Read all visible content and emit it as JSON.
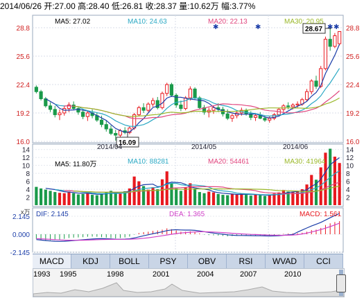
{
  "header": {
    "date": "2014/06/26",
    "open": "开:27.00",
    "high": "高:28.40",
    "low": "低:26.81",
    "close": "收:28.37",
    "volume": "量:10.62万",
    "change": "幅:3.77%"
  },
  "price_panel": {
    "ma5": "MA5: 27.02",
    "ma10": "MA10: 24.63",
    "ma20": "MA20: 22.13",
    "ma30": "MA30: 20.95",
    "y_ticks": [
      "28.8",
      "25.6",
      "22.4",
      "19.2",
      "16.0"
    ],
    "x_labels": [
      "2014/04",
      "2014/05",
      "2014/06"
    ],
    "high_callout": "28.67",
    "low_callout": "16.09"
  },
  "volume_panel": {
    "ma5": "MA5: 11.80万",
    "ma10": "MA10: 88281",
    "ma20": "MA20: 54461",
    "ma30": "MA30: 41964",
    "y_ticks": [
      "14",
      "12",
      "10",
      "8",
      "6",
      "4",
      "2"
    ],
    "unit": "x万"
  },
  "macd_panel": {
    "dif": "DIF: 2.145",
    "dea": "DEA: 1.365",
    "macd": "MACD: 1.561",
    "y_ticks": [
      "2.145",
      "0.000",
      "-2.145"
    ]
  },
  "tabs": [
    "MACD",
    "KDJ",
    "BOLL",
    "PSY",
    "OBV",
    "RSI",
    "WVAD",
    "CCI"
  ],
  "timeline": {
    "years": [
      "1993",
      "1995",
      "1998",
      "2001",
      "2004",
      "2007",
      "2010"
    ]
  },
  "colors": {
    "up": "#e8191f",
    "down": "#1a9a4a",
    "ma5": "#1b3da8",
    "ma10": "#2aa8c4",
    "ma20": "#e0457e",
    "ma30": "#9ab82a",
    "dif": "#1b3da8",
    "dea": "#d040c8"
  },
  "chart_data": {
    "type": "candlestick",
    "ylim": [
      16.0,
      28.8
    ],
    "ohlc": [
      [
        22.1,
        22.3,
        21.4,
        21.6
      ],
      [
        21.6,
        21.8,
        20.6,
        20.8
      ],
      [
        20.8,
        21.0,
        19.8,
        20.0
      ],
      [
        20.0,
        20.4,
        19.3,
        19.6
      ],
      [
        19.6,
        20.0,
        18.7,
        19.0
      ],
      [
        19.0,
        19.6,
        18.4,
        19.2
      ],
      [
        19.2,
        20.0,
        18.9,
        19.7
      ],
      [
        19.7,
        20.4,
        19.3,
        20.1
      ],
      [
        20.1,
        20.5,
        19.5,
        19.7
      ],
      [
        19.7,
        19.9,
        19.0,
        19.3
      ],
      [
        19.3,
        19.7,
        18.5,
        18.8
      ],
      [
        18.8,
        19.4,
        18.3,
        19.2
      ],
      [
        19.2,
        19.6,
        18.6,
        18.9
      ],
      [
        18.9,
        19.2,
        18.2,
        18.4
      ],
      [
        18.4,
        18.9,
        17.6,
        17.9
      ],
      [
        17.9,
        18.3,
        17.1,
        17.4
      ],
      [
        17.4,
        17.8,
        16.7,
        16.9
      ],
      [
        16.9,
        17.3,
        16.09,
        16.7
      ],
      [
        16.7,
        17.4,
        16.4,
        17.2
      ],
      [
        17.2,
        17.6,
        16.8,
        17.0
      ],
      [
        17.0,
        17.7,
        16.8,
        17.5
      ],
      [
        17.5,
        19.2,
        17.3,
        19.0
      ],
      [
        19.0,
        20.0,
        18.8,
        19.8
      ],
      [
        19.8,
        20.3,
        19.2,
        19.5
      ],
      [
        19.5,
        20.4,
        19.3,
        20.2
      ],
      [
        20.2,
        20.9,
        19.9,
        20.6
      ],
      [
        20.6,
        21.0,
        19.6,
        19.8
      ],
      [
        19.8,
        21.6,
        19.6,
        21.4
      ],
      [
        21.4,
        22.6,
        21.1,
        22.4
      ],
      [
        22.4,
        22.6,
        21.0,
        21.2
      ],
      [
        21.2,
        21.4,
        19.8,
        20.1
      ],
      [
        20.1,
        20.6,
        19.4,
        19.7
      ],
      [
        19.7,
        21.1,
        19.5,
        20.9
      ],
      [
        20.9,
        22.2,
        20.6,
        21.9
      ],
      [
        21.9,
        22.1,
        20.7,
        20.9
      ],
      [
        20.9,
        21.1,
        19.6,
        19.8
      ],
      [
        19.8,
        20.1,
        19.0,
        19.3
      ],
      [
        19.3,
        19.8,
        18.7,
        19.5
      ],
      [
        19.5,
        20.0,
        19.1,
        19.8
      ],
      [
        19.8,
        20.3,
        19.3,
        19.6
      ],
      [
        19.6,
        19.9,
        18.8,
        19.1
      ],
      [
        19.1,
        19.6,
        18.4,
        18.6
      ],
      [
        18.6,
        19.1,
        18.2,
        18.9
      ],
      [
        18.9,
        19.4,
        18.6,
        19.2
      ],
      [
        19.2,
        19.8,
        18.9,
        19.5
      ],
      [
        19.5,
        19.7,
        18.9,
        19.1
      ],
      [
        19.1,
        19.4,
        18.4,
        18.7
      ],
      [
        18.7,
        19.1,
        18.3,
        18.9
      ],
      [
        18.9,
        19.3,
        18.5,
        18.6
      ],
      [
        18.6,
        18.9,
        18.2,
        18.4
      ],
      [
        18.4,
        18.8,
        18.1,
        18.6
      ],
      [
        18.6,
        19.2,
        18.4,
        19.0
      ],
      [
        19.0,
        19.8,
        18.8,
        19.6
      ],
      [
        19.6,
        20.2,
        19.3,
        20.0
      ],
      [
        20.0,
        20.4,
        19.6,
        19.9
      ],
      [
        19.9,
        20.3,
        19.6,
        20.1
      ],
      [
        20.1,
        20.5,
        19.8,
        20.2
      ],
      [
        20.2,
        20.9,
        20.0,
        20.7
      ],
      [
        20.7,
        21.9,
        20.5,
        21.6
      ],
      [
        21.6,
        23.0,
        21.3,
        22.8
      ],
      [
        22.8,
        23.4,
        21.9,
        22.2
      ],
      [
        22.2,
        24.5,
        22.0,
        24.2
      ],
      [
        24.2,
        27.8,
        24.0,
        27.5
      ],
      [
        27.5,
        28.67,
        26.2,
        26.7
      ],
      [
        26.7,
        28.2,
        26.5,
        27.9
      ],
      [
        27.0,
        28.4,
        26.81,
        28.37
      ]
    ],
    "volume": [
      4.6,
      4.2,
      3.9,
      3.6,
      3.3,
      3.1,
      3.0,
      3.4,
      3.0,
      2.7,
      2.8,
      3.1,
      2.6,
      2.5,
      2.9,
      3.2,
      3.6,
      3.3,
      3.0,
      3.5,
      4.2,
      7.2,
      6.0,
      4.8,
      3.9,
      4.5,
      4.0,
      6.5,
      8.5,
      5.4,
      4.2,
      3.6,
      4.4,
      5.5,
      4.0,
      3.3,
      3.0,
      3.4,
      3.2,
      2.8,
      2.6,
      2.5,
      2.9,
      2.7,
      2.9,
      2.6,
      2.4,
      2.7,
      2.5,
      2.3,
      2.6,
      2.9,
      3.2,
      3.8,
      3.4,
      3.3,
      3.5,
      4.0,
      5.2,
      7.6,
      6.4,
      9.5,
      13.2,
      14.2,
      12.2,
      10.6
    ],
    "macd_hist": [
      -0.55,
      -0.65,
      -0.7,
      -0.72,
      -0.7,
      -0.65,
      -0.55,
      -0.45,
      -0.4,
      -0.38,
      -0.35,
      -0.3,
      -0.28,
      -0.3,
      -0.35,
      -0.4,
      -0.45,
      -0.5,
      -0.45,
      -0.38,
      -0.28,
      -0.05,
      0.15,
      0.25,
      0.3,
      0.4,
      0.45,
      0.55,
      0.7,
      0.6,
      0.45,
      0.3,
      0.3,
      0.35,
      0.25,
      0.1,
      -0.05,
      -0.1,
      -0.12,
      -0.15,
      -0.2,
      -0.25,
      -0.22,
      -0.18,
      -0.12,
      -0.12,
      -0.15,
      -0.15,
      -0.16,
      -0.18,
      -0.16,
      -0.12,
      -0.05,
      0.05,
      0.08,
      0.1,
      0.12,
      0.18,
      0.3,
      0.5,
      0.55,
      0.75,
      1.1,
      1.3,
      1.45,
      1.56
    ],
    "macd_ylim": [
      -2.145,
      2.145
    ]
  }
}
